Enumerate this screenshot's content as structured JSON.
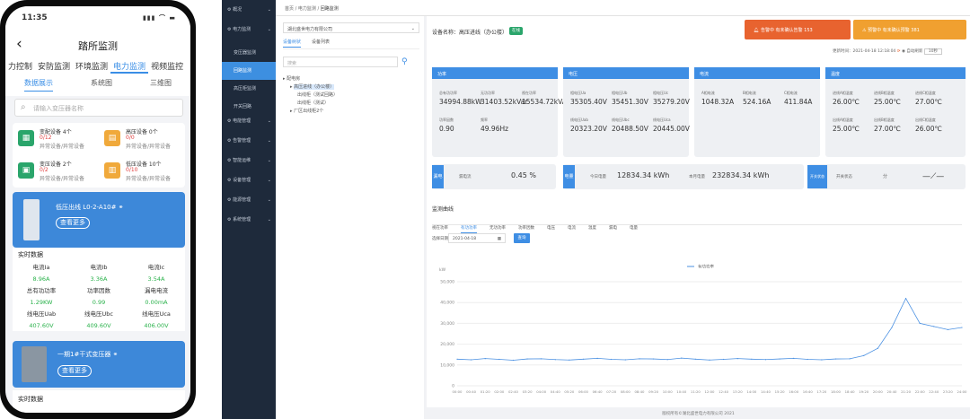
{
  "phone": {
    "time": "11:35",
    "status_icons": "▮▮▮ ⌒ ▬",
    "title": "踏所监测",
    "tabs": [
      "力控制",
      "安防监测",
      "环境监测",
      "电力监测",
      "视频监控"
    ],
    "active_tab": 3,
    "subtabs": [
      "数据展示",
      "系统图",
      "三维图"
    ],
    "search_placeholder": "请输入变压器名称",
    "cards": [
      {
        "t1": "变配设备 4个",
        "t2": "0/12",
        "t3": "异常设备/异常设备",
        "color": "#2aa56b",
        "icon": "grid-icon"
      },
      {
        "t1": "高压设备 0个",
        "t2": "0/0",
        "t3": "异常设备/异常设备",
        "color": "#f0a93b",
        "icon": "device-icon"
      },
      {
        "t1": "变压设备 2个",
        "t2": "0/2",
        "t3": "异常设备/异常设备",
        "color": "#2aa56b",
        "icon": "transformer-icon"
      },
      {
        "t1": "低压设备 10个",
        "t2": "0/10",
        "t3": "异常设备/异常设备",
        "color": "#f0a93b",
        "icon": "lowvolt-icon"
      }
    ],
    "block1_title": "低压出线 L0-2-A10#",
    "more_button": "查看更多",
    "realtime_header": "实时数据",
    "metrics": [
      {
        "label": "电流Ia",
        "value": "8.96A"
      },
      {
        "label": "电流Ib",
        "value": "3.36A"
      },
      {
        "label": "电流Ic",
        "value": "3.54A"
      },
      {
        "label": "总有功功率",
        "value": "1.29KW"
      },
      {
        "label": "功率因数",
        "value": "0.99"
      },
      {
        "label": "漏电电流",
        "value": "0.00mA"
      },
      {
        "label": "线电压Uab",
        "value": "407.60V"
      },
      {
        "label": "线电压Ubc",
        "value": "409.60V"
      },
      {
        "label": "线电压Uca",
        "value": "406.00V"
      }
    ],
    "block2_title": "一期1#干式变压器",
    "block2_more": "查看更多",
    "realtime_header2": "实时数据"
  },
  "sidebar": {
    "items": [
      {
        "label": "概况",
        "type": "top"
      },
      {
        "label": "电力监测",
        "type": "top"
      },
      {
        "label": "变压器监测",
        "type": "sub"
      },
      {
        "label": "回路监测",
        "type": "sub",
        "active": true
      },
      {
        "label": "高压柜监测",
        "type": "sub"
      },
      {
        "label": "开关回路",
        "type": "sub"
      },
      {
        "label": "电能管理",
        "type": "top"
      },
      {
        "label": "告警管理",
        "type": "top"
      },
      {
        "label": "智能运维",
        "type": "top"
      },
      {
        "label": "设备管理",
        "type": "top"
      },
      {
        "label": "能源管理",
        "type": "top"
      },
      {
        "label": "系统管理",
        "type": "top"
      }
    ]
  },
  "web": {
    "breadcrumb": [
      "首页",
      "电力监测",
      "回路监测"
    ],
    "company_select": "湖北盛世电力有限公司",
    "tree_tabs": [
      "设备树状",
      "设备列表"
    ],
    "tree_search": "搜索",
    "tree": [
      {
        "label": "配电房",
        "level": 0
      },
      {
        "label": "高压进线（办公楼）",
        "level": 1,
        "selected": true
      },
      {
        "label": "出线柜（测试回路）",
        "level": 2
      },
      {
        "label": "出线柜（测试）",
        "level": 2
      },
      {
        "label": "厂区出线柜2个",
        "level": 1
      }
    ],
    "device_label": "设备名称：高压进线（办公楼）",
    "online_badge": "在线",
    "alarm_red": "告警中  有未确认告警  153",
    "alarm_orange": "预警中  有未确认预警  381",
    "update_time": "更新时间：2021-04-18 12:18:04",
    "refresh_label": "自动刷新",
    "refresh_value": "10秒",
    "panels": [
      {
        "title": "功率",
        "items": [
          [
            "总有功功率",
            "34994.88kW"
          ],
          [
            "无功功率",
            "31403.52kVar"
          ],
          [
            "视在功率",
            "15534.72kVA"
          ],
          [
            "功率因数",
            "0.90"
          ],
          [
            "频率",
            "49.96Hz"
          ]
        ]
      },
      {
        "title": "电压",
        "items": [
          [
            "相电压Ua",
            "35305.40V"
          ],
          [
            "相电压Ub",
            "35451.30V"
          ],
          [
            "相电压Uc",
            "35279.20V"
          ],
          [
            "线电压Uab",
            "20323.20V"
          ],
          [
            "线电压Ubc",
            "20488.50V"
          ],
          [
            "线电压Uca",
            "20445.00V"
          ]
        ]
      },
      {
        "title": "电流",
        "items": [
          [
            "A相电流",
            "1048.32A"
          ],
          [
            "B相电流",
            "524.16A"
          ],
          [
            "C相电流",
            "411.84A"
          ]
        ]
      },
      {
        "title": "温度",
        "items": [
          [
            "进线A相温度",
            "26.00℃"
          ],
          [
            "进线B相温度",
            "25.00℃"
          ],
          [
            "进线C相温度",
            "27.00℃"
          ],
          [
            "出线A相温度",
            "25.00℃"
          ],
          [
            "出线B相温度",
            "27.00℃"
          ],
          [
            "出线C相温度",
            "26.00℃"
          ]
        ]
      }
    ],
    "leak_tag": "漏电",
    "leak_label": "漏电流",
    "leak_value": "0.45 %",
    "energy_tag": "电量",
    "energy_today_label": "今日电量",
    "energy_today": "12834.34 kWh",
    "energy_month_label": "本月电量",
    "energy_month": "232834.34 kWh",
    "switch_tag": "开关状态",
    "switch_label": "开关状态",
    "switch_value": "分",
    "curve_title": "监测曲线",
    "curve_tabs": [
      "视在功率",
      "有功功率",
      "无功功率",
      "功率因数",
      "电压",
      "电流",
      "温度",
      "漏电",
      "电量"
    ],
    "curve_active": 1,
    "date_label": "选择日期",
    "date_value": "2021-04-18",
    "query_button": "查询",
    "footer": "版权所有©湖北盛世电力有限公司 2021",
    "colors": {
      "blue": "#3e8ee4",
      "red": "#e8632f",
      "orange": "#f0a030"
    }
  },
  "chart_data": {
    "type": "line",
    "title": "",
    "xlabel": "",
    "ylabel": "kW",
    "ylim": [
      0,
      50000
    ],
    "y_ticks": [
      "0",
      "10,000",
      "20,000",
      "30,000",
      "40,000",
      "50,000"
    ],
    "legend": "top",
    "series": [
      {
        "name": "有功功率",
        "x": [
          "00:00",
          "00:40",
          "01:20",
          "02:00",
          "02:40",
          "03:20",
          "04:00",
          "04:40",
          "05:20",
          "06:00",
          "06:40",
          "07:20",
          "08:00",
          "08:40",
          "09:20",
          "10:00",
          "10:40",
          "11:20",
          "12:00",
          "12:40",
          "13:20",
          "14:00",
          "14:40",
          "15:20",
          "16:00",
          "16:40",
          "17:20",
          "18:00",
          "18:40",
          "19:20",
          "20:00",
          "20:40",
          "21:20",
          "22:00",
          "22:40",
          "23:20",
          "24:00"
        ],
        "values": [
          12800,
          12500,
          13100,
          12700,
          12300,
          12900,
          13000,
          12600,
          12400,
          12800,
          13200,
          12700,
          12500,
          13000,
          12900,
          12600,
          13300,
          12800,
          12400,
          12700,
          13100,
          12800,
          12600,
          12900,
          13200,
          12700,
          12500,
          12900,
          13000,
          14500,
          18000,
          28000,
          42000,
          30000,
          28500,
          27000,
          28000
        ]
      }
    ]
  }
}
